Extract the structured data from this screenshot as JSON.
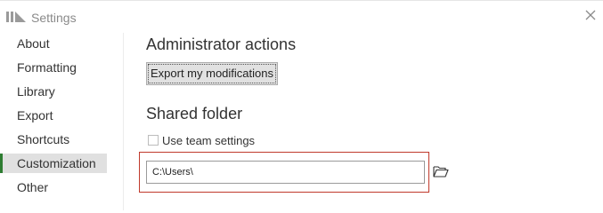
{
  "window": {
    "title": "Settings",
    "logo_icon": "app-logo-icon",
    "close_icon": "close-icon"
  },
  "sidebar": {
    "items": [
      {
        "label": "About",
        "active": false
      },
      {
        "label": "Formatting",
        "active": false
      },
      {
        "label": "Library",
        "active": false
      },
      {
        "label": "Export",
        "active": false
      },
      {
        "label": "Shortcuts",
        "active": false
      },
      {
        "label": "Customization",
        "active": true
      },
      {
        "label": "Other",
        "active": false
      }
    ],
    "active_accent": "#2e7d32"
  },
  "admin": {
    "heading": "Administrator actions",
    "export_label": "Export my modifications"
  },
  "shared": {
    "heading": "Shared folder",
    "team_checkbox_label": "Use team settings",
    "team_checked": false,
    "path_value": "C:\\Users\\",
    "folder_icon": "folder-open-icon",
    "highlight_color": "#c0392b"
  }
}
